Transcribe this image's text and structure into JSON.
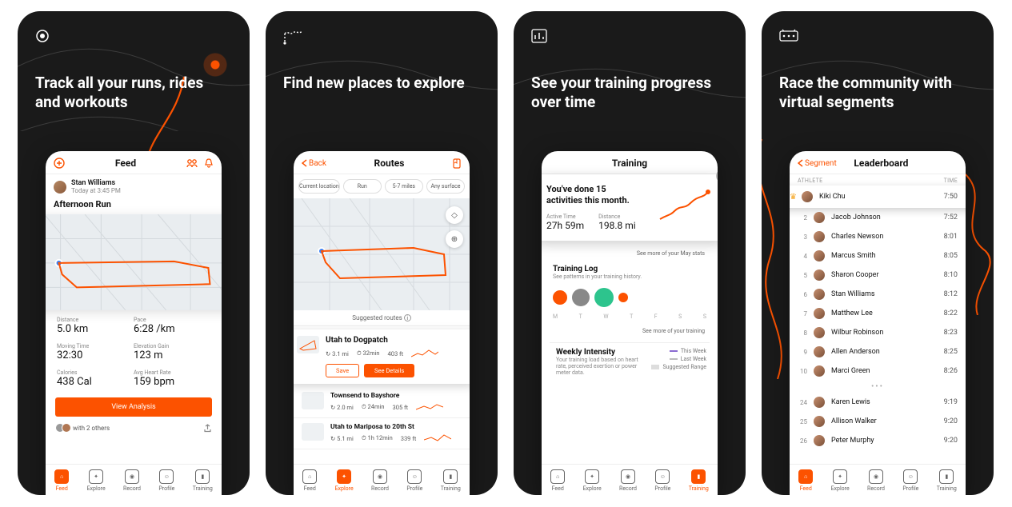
{
  "cards": [
    {
      "headline": "Track all your runs, rides and workouts"
    },
    {
      "headline": "Find new places to explore"
    },
    {
      "headline": "See your training progress over time"
    },
    {
      "headline": "Race the community with virtual segments"
    }
  ],
  "tabs": {
    "feed": "Feed",
    "explore": "Explore",
    "record": "Record",
    "profile": "Profile",
    "training": "Training"
  },
  "feed": {
    "header": "Feed",
    "user": "Stan Williams",
    "timestamp": "Today at 3:45 PM",
    "activity_title": "Afternoon Run",
    "stats": [
      {
        "label": "Distance",
        "value": "5.0 km"
      },
      {
        "label": "Pace",
        "value": "6:28 /km"
      },
      {
        "label": "Moving Time",
        "value": "32:30"
      },
      {
        "label": "Elevation Gain",
        "value": "123 m"
      },
      {
        "label": "Calories",
        "value": "438 Cal"
      },
      {
        "label": "Avg Heart Rate",
        "value": "159 bpm"
      }
    ],
    "analysis_btn": "View Analysis",
    "with_others": "with 2 others"
  },
  "routes": {
    "back": "Back",
    "header": "Routes",
    "chips": [
      "Current location",
      "Run",
      "5-7 miles",
      "Any surface"
    ],
    "suggested": "Suggested routes",
    "featured": {
      "name": "Utah to Dogpatch",
      "dist": "3.1 mi",
      "time": "32min",
      "elev": "403 ft",
      "save": "Save",
      "details": "See Details"
    },
    "list": [
      {
        "name": "Townsend to Bayshore",
        "dist": "2.0 mi",
        "time": "24min",
        "elev": "305 ft"
      },
      {
        "name": "Utah to Mariposa to 20th St",
        "dist": "5.1 mi",
        "time": "1h 12min",
        "elev": "339 ft"
      }
    ]
  },
  "training": {
    "header": "Training",
    "card_title": "You've done 15 activities this month.",
    "active_time_label": "Active Time",
    "active_time": "27h 59m",
    "distance_label": "Distance",
    "distance": "198.8 mi",
    "see_more_month": "See more of your May stats",
    "log_title": "Training Log",
    "log_sub": "See patterns in your training history.",
    "days": [
      "M",
      "T",
      "W",
      "T",
      "F",
      "S",
      "S"
    ],
    "see_more_log": "See more of your training",
    "weekly_title": "Weekly Intensity",
    "weekly_sub": "Your training load based on heart rate, perceived exertion or power meter data.",
    "legend": [
      "This Week",
      "Last Week",
      "Suggested Range"
    ]
  },
  "leaderboard": {
    "back": "Segment",
    "header": "Leaderboard",
    "col_athlete": "Athlete",
    "col_time": "Time",
    "rows": [
      {
        "rank": "",
        "name": "Kiki Chu",
        "time": "7:50",
        "crown": true
      },
      {
        "rank": "2",
        "name": "Jacob Johnson",
        "time": "7:52"
      },
      {
        "rank": "3",
        "name": "Charles Newson",
        "time": "8:01"
      },
      {
        "rank": "4",
        "name": "Marcus Smith",
        "time": "8:05"
      },
      {
        "rank": "5",
        "name": "Sharon Cooper",
        "time": "8:10"
      },
      {
        "rank": "6",
        "name": "Stan Williams",
        "time": "8:12"
      },
      {
        "rank": "7",
        "name": "Matthew Lee",
        "time": "8:22"
      },
      {
        "rank": "8",
        "name": "Wilbur Robinson",
        "time": "8:23"
      },
      {
        "rank": "9",
        "name": "Allen Anderson",
        "time": "8:25"
      },
      {
        "rank": "10",
        "name": "Marci Green",
        "time": "8:26"
      }
    ],
    "rows2": [
      {
        "rank": "24",
        "name": "Karen Lewis",
        "time": "9:19"
      },
      {
        "rank": "25",
        "name": "Allison Walker",
        "time": "9:20"
      },
      {
        "rank": "26",
        "name": "Peter Murphy",
        "time": "9:20"
      }
    ]
  }
}
